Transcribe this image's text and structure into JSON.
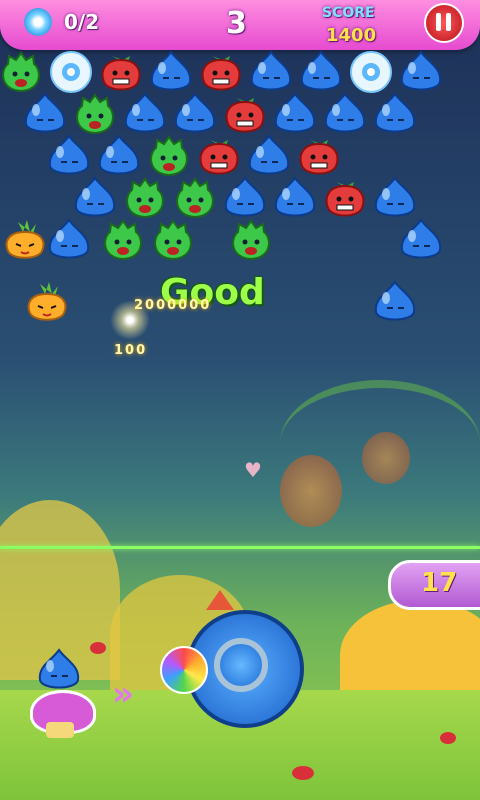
{
  "hud": {
    "flower_count": "0/2",
    "level_number": "3",
    "score_label": "SCORE",
    "score_value": "1400",
    "pause_icon": "pause-icon"
  },
  "colors": {
    "hud_bg": "#f06ad8",
    "blue_jelly": "#2f7de8",
    "green_jelly": "#3ec84a",
    "strawberry": "#e43c3c",
    "pineapple": "#ffae2b",
    "shots_badge": "#c86be0"
  },
  "popup": {
    "combo_text": "Good",
    "combo_score": "2000000",
    "points": "100"
  },
  "shots_left": "17",
  "arrow_icon": "double-chevron-right-icon",
  "board_rows": [
    [
      "green",
      "flower",
      "strawberry",
      "blue",
      "strawberry",
      "blue",
      "blue",
      "flower",
      "blue"
    ],
    [
      "blue",
      "green",
      "blue",
      "blue",
      "strawberry",
      "blue",
      "blue",
      "blue"
    ],
    [
      "blue",
      "blue",
      "green",
      "strawberry",
      "blue",
      "strawberry"
    ],
    [
      "blue",
      "green",
      "green",
      "blue",
      "blue",
      "strawberry",
      "blue"
    ],
    [
      "pineapple",
      "blue",
      "green",
      "green",
      "green",
      "blue"
    ],
    [
      "pineapple",
      "blue"
    ]
  ]
}
